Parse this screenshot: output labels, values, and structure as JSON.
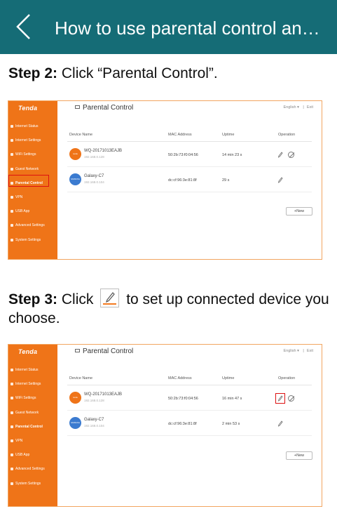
{
  "header": {
    "title": "How to use parental control an…",
    "back_icon": "chevron-left-icon",
    "color": "#156c76"
  },
  "steps": [
    {
      "label": "Step 2:",
      "text": "Click “Parental Control”.",
      "screenshot": {
        "brand": "Tenda",
        "page_title": "Parental Control",
        "language": "English",
        "exit_label": "Exit",
        "menu": [
          "Internet Status",
          "Internet Settings",
          "WiFi Settings",
          "Guest Network",
          "Parental Control",
          "VPN",
          "USB App",
          "Advanced Settings",
          "System Settings"
        ],
        "active_menu": "Parental Control",
        "columns": [
          "Device Name",
          "MAC Address",
          "Uptime",
          "Operation"
        ],
        "rows": [
          {
            "avatar": "tenda",
            "name": "WQ-20171013EAJB",
            "ip": "192.168.0.128",
            "mac": "50:2b:73:f0:04:56",
            "uptime": "14 min 23 s"
          },
          {
            "avatar": "SAMSUNG",
            "name": "Galaxy-C7",
            "ip": "192.168.0.104",
            "mac": "dc:cf:96:3e:81:8f",
            "uptime": "29 s"
          }
        ],
        "new_button": "+New"
      }
    },
    {
      "label": "Step 3:",
      "text_before": "Click",
      "text_after": "to set up connected device you choose.",
      "screenshot": {
        "brand": "Tenda",
        "page_title": "Parental Control",
        "language": "English",
        "exit_label": "Exit",
        "menu": [
          "Internet Status",
          "Internet Settings",
          "WiFi Settings",
          "Guest Network",
          "Parental Control",
          "VPN",
          "USB App",
          "Advanced Settings",
          "System Settings"
        ],
        "active_menu": "Parental Control",
        "columns": [
          "Device Name",
          "MAC Address",
          "Uptime",
          "Operation"
        ],
        "rows": [
          {
            "avatar": "tenda",
            "name": "WQ-20171013EAJB",
            "ip": "192.168.0.128",
            "mac": "50:2b:73:f0:04:56",
            "uptime": "16 min 47 s"
          },
          {
            "avatar": "SAMSUNG",
            "name": "Galaxy-C7",
            "ip": "192.168.0.104",
            "mac": "dc:cf:96:3e:81:8f",
            "uptime": "2 min 53 s"
          }
        ],
        "new_button": "+New"
      }
    }
  ],
  "colors": {
    "accent": "#ef7418",
    "highlight": "#dd1111",
    "samsung": "#3b7bd0"
  }
}
